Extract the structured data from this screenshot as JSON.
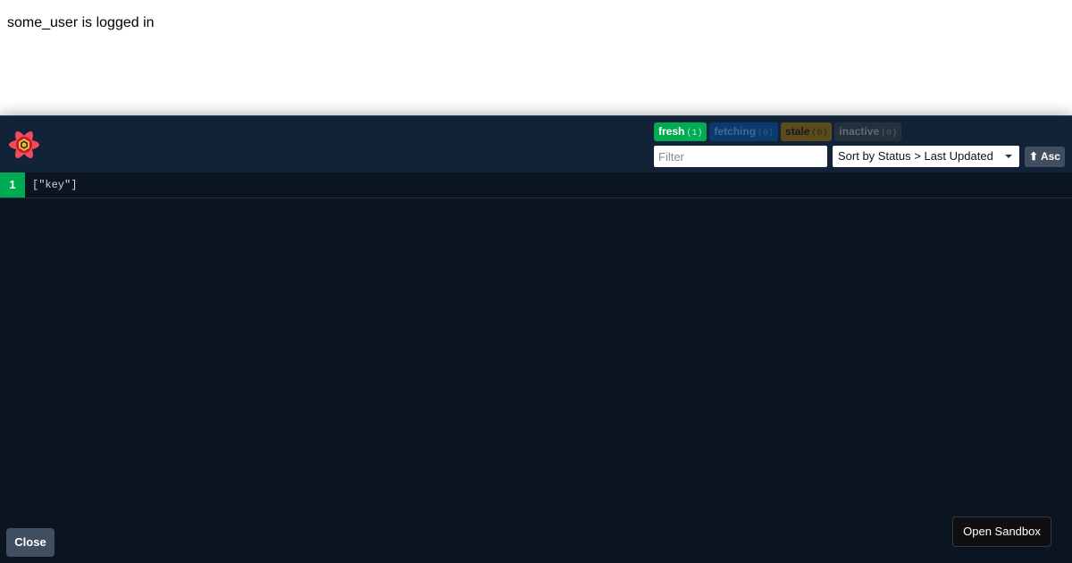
{
  "app": {
    "status_text": "some_user is logged in"
  },
  "devtools": {
    "logo_icon": "react-query-flower-logo",
    "status_badges": [
      {
        "label": "fresh",
        "count": "(1)",
        "bg": "#00ab52",
        "fg": "#ffffff"
      },
      {
        "label": "fetching",
        "count": "(0)",
        "bg": "#0b3a6e",
        "fg": "#3f6a9a"
      },
      {
        "label": "stale",
        "count": "(0)",
        "bg": "#5a4a1c",
        "fg": "#1a1a1a"
      },
      {
        "label": "inactive",
        "count": "(0)",
        "bg": "#25303c",
        "fg": "#5f6b78"
      }
    ],
    "filter": {
      "placeholder": "Filter",
      "value": ""
    },
    "sort": {
      "selected": "Sort by Status > Last Updated"
    },
    "sort_direction": {
      "icon": "up-arrow-icon",
      "label": "⬆ Asc"
    },
    "queries": [
      {
        "observers": "1",
        "key": "[\"key\"]",
        "status_color": "#00ab52"
      }
    ],
    "close_label": "Close",
    "open_sandbox_label": "Open Sandbox"
  },
  "colors": {
    "panel_bg": "#0b1521",
    "header_bg": "#132337",
    "button_gray": "#3f4e60",
    "fresh_green": "#00ab52"
  }
}
